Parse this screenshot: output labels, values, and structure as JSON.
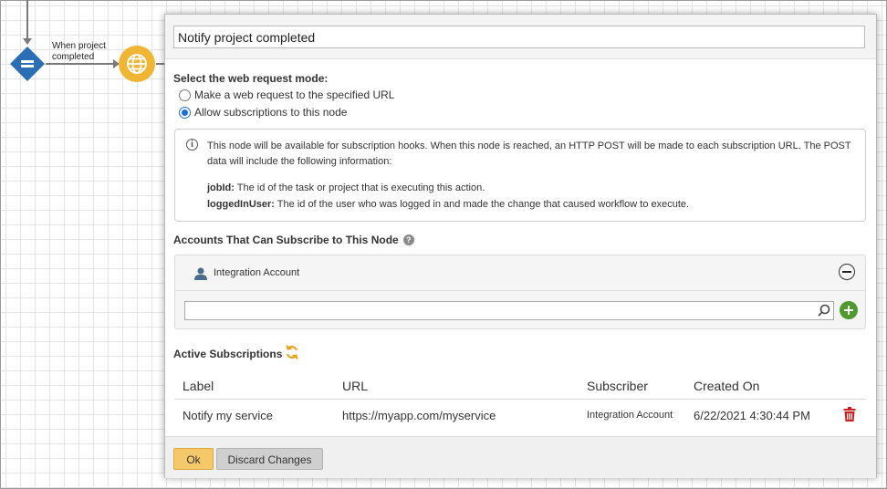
{
  "canvas": {
    "event_label": "When project completed"
  },
  "dialog": {
    "title_value": "Notify project completed",
    "mode_heading": "Select the web request mode:",
    "mode_options": [
      {
        "label": "Make a web request to the specified URL",
        "selected": false
      },
      {
        "label": "Allow subscriptions to this node",
        "selected": true
      }
    ],
    "info": {
      "text": "This node will be available for subscription hooks. When this node is reached, an HTTP POST will be made to each subscription URL. The POST data will include the following information:",
      "fields": [
        {
          "name": "jobId:",
          "desc": " The id of the task or project that is executing this action."
        },
        {
          "name": "loggedInUser:",
          "desc": " The id of the user who was logged in and made the change that caused workflow to execute."
        }
      ]
    },
    "accounts": {
      "heading": "Accounts That Can Subscribe to This Node",
      "items": [
        "Integration Account"
      ],
      "search_value": ""
    },
    "subscriptions": {
      "heading": "Active Subscriptions",
      "columns": [
        "Label",
        "URL",
        "Subscriber",
        "Created On"
      ],
      "rows": [
        {
          "label": "Notify my service",
          "url": "https://myapp.com/myservice",
          "subscriber": "Integration Account",
          "created_on": "6/22/2021 4:30:44 PM"
        }
      ]
    },
    "footer": {
      "ok_label": "Ok",
      "discard_label": "Discard Changes"
    }
  },
  "colors": {
    "accent_yellow": "#f1b534",
    "decision_blue": "#2a6eb6",
    "add_green": "#4e9a2e",
    "delete_red": "#cc1f1f",
    "radio_blue": "#1a6fd6"
  }
}
